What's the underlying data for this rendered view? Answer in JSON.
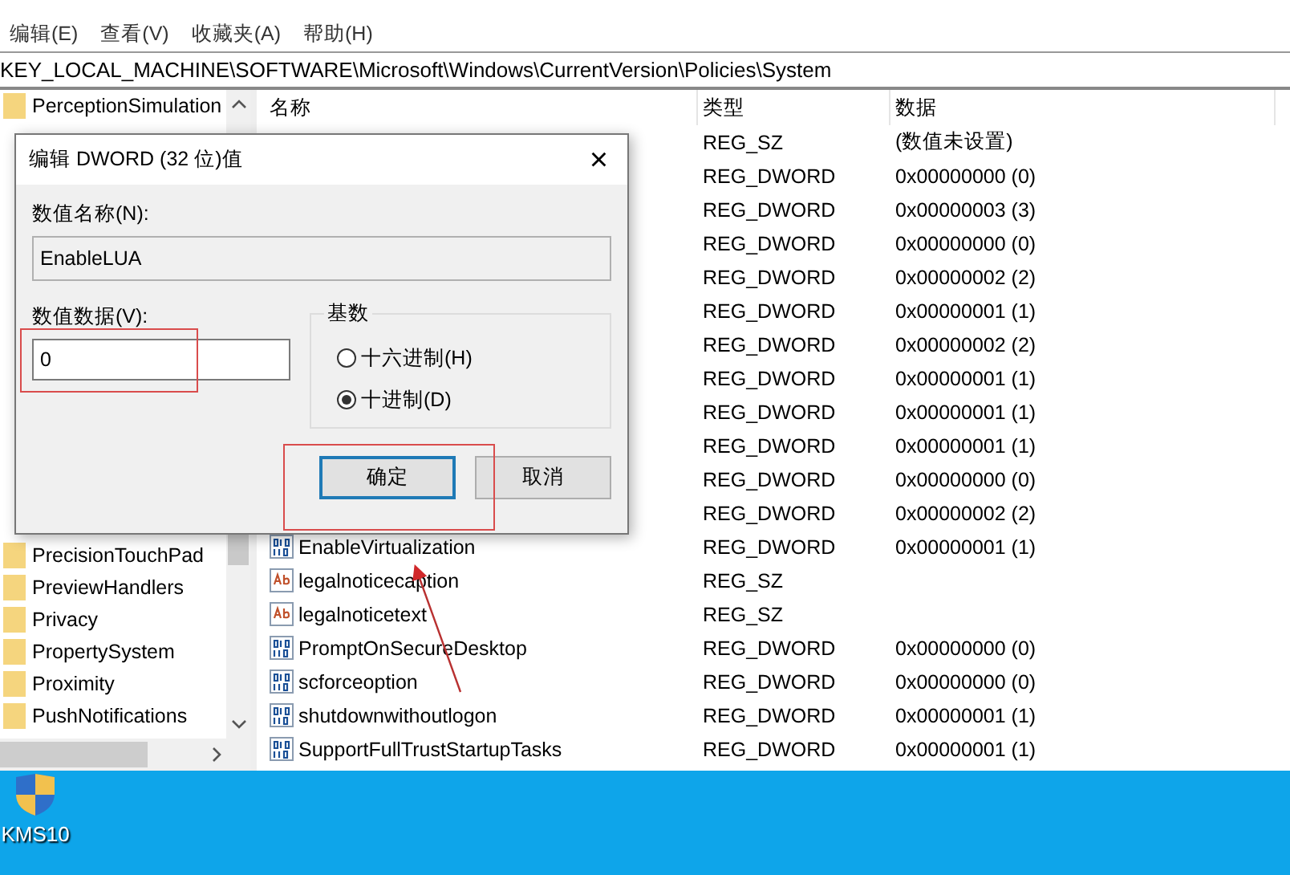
{
  "menu": [
    "编辑(E)",
    "查看(V)",
    "收藏夹(A)",
    "帮助(H)"
  ],
  "address": "KEY_LOCAL_MACHINE\\SOFTWARE\\Microsoft\\Windows\\CurrentVersion\\Policies\\System",
  "tree": {
    "top_items": [
      "PerceptionSimulation"
    ],
    "bottom_items": [
      "PrecisionTouchPad",
      "PreviewHandlers",
      "Privacy",
      "PropertySystem",
      "Proximity",
      "PushNotifications"
    ]
  },
  "table": {
    "columns": [
      "名称",
      "类型",
      "数据"
    ],
    "rows": [
      {
        "type": "REG_SZ",
        "data": "(数值未设置)"
      },
      {
        "type": "REG_DWORD",
        "data": "0x00000000 (0)"
      },
      {
        "type": "REG_DWORD",
        "data": "0x00000003 (3)"
      },
      {
        "type": "REG_DWORD",
        "data": "0x00000000 (0)"
      },
      {
        "type": "REG_DWORD",
        "data": "0x00000002 (2)"
      },
      {
        "type": "REG_DWORD",
        "data": "0x00000001 (1)"
      },
      {
        "type": "REG_DWORD",
        "data": "0x00000002 (2)"
      },
      {
        "type": "REG_DWORD",
        "data": "0x00000001 (1)"
      },
      {
        "type": "REG_DWORD",
        "data": "0x00000001 (1)"
      },
      {
        "type": "REG_DWORD",
        "data": "0x00000001 (1)"
      },
      {
        "type": "REG_DWORD",
        "data": "0x00000000 (0)"
      },
      {
        "type": "REG_DWORD",
        "data": "0x00000002 (2)"
      },
      {
        "kind": "dword",
        "name": "EnableVirtualization",
        "type": "REG_DWORD",
        "data": "0x00000001 (1)"
      },
      {
        "kind": "string",
        "name": "legalnoticecaption",
        "type": "REG_SZ"
      },
      {
        "kind": "string",
        "name": "legalnoticetext",
        "type": "REG_SZ"
      },
      {
        "kind": "dword",
        "name": "PromptOnSecureDesktop",
        "type": "REG_DWORD",
        "data": "0x00000000 (0)"
      },
      {
        "kind": "dword",
        "name": "scforceoption",
        "type": "REG_DWORD",
        "data": "0x00000000 (0)"
      },
      {
        "kind": "dword",
        "name": "shutdownwithoutlogon",
        "type": "REG_DWORD",
        "data": "0x00000001 (1)"
      },
      {
        "kind": "dword",
        "name": "SupportFullTrustStartupTasks",
        "type": "REG_DWORD",
        "data": "0x00000001 (1)"
      }
    ]
  },
  "dialog": {
    "title": "编辑 DWORD (32 位)值",
    "close": "×",
    "name_label": "数值名称(N):",
    "name_value": "EnableLUA",
    "data_label": "数值数据(V):",
    "data_value": "0",
    "base_label": "基数",
    "bases": [
      {
        "label": "十六进制(H)",
        "selected": false
      },
      {
        "label": "十进制(D)",
        "selected": true
      }
    ],
    "buttons": [
      {
        "label": "确定",
        "focused": true
      },
      {
        "label": "取消",
        "focused": false
      }
    ]
  },
  "desktop_icons": [
    {
      "label": "KMS10"
    }
  ]
}
